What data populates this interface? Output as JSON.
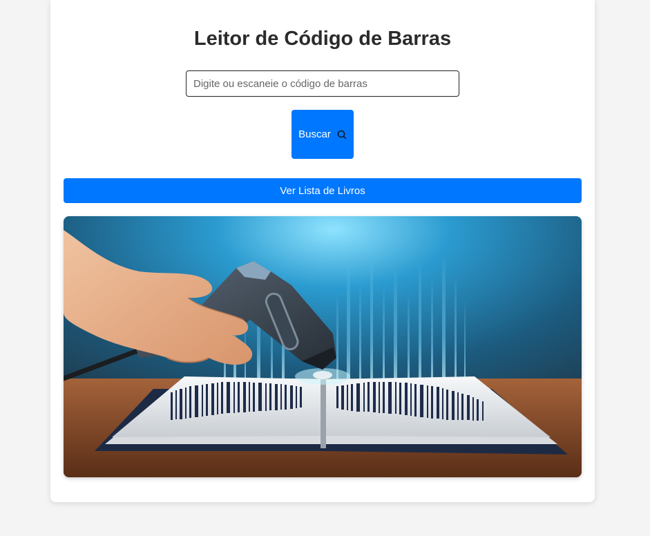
{
  "header": {
    "title": "Leitor de Código de Barras"
  },
  "search": {
    "placeholder": "Digite ou escaneie o código de barras",
    "value": "",
    "button_label": "Buscar",
    "button_icon": "search-icon"
  },
  "actions": {
    "list_button_label": "Ver Lista de Livros"
  },
  "hero": {
    "image_description_icon": "barcode-scanner-book-image"
  },
  "colors": {
    "accent": "#0077ff",
    "background": "#f4f4f4",
    "card": "#ffffff",
    "title": "#2b2b2b"
  }
}
